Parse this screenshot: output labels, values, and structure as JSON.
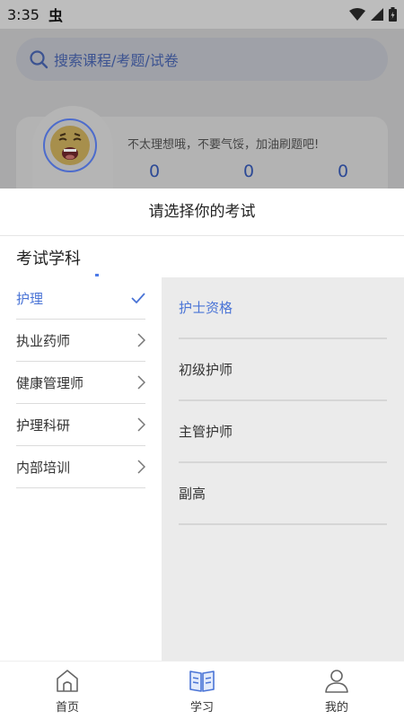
{
  "status_bar": {
    "time": "3:35",
    "app_glyph": "虫"
  },
  "search": {
    "placeholder": "搜索课程/考题/试卷"
  },
  "stats": {
    "motivation": "不太理想哦，不要气馁，加油刷题吧!",
    "values": [
      "0",
      "0",
      "0"
    ]
  },
  "sheet": {
    "title": "请选择你的考试",
    "section_title": "考试学科",
    "categories": [
      {
        "label": "护理",
        "selected": true
      },
      {
        "label": "执业药师",
        "selected": false
      },
      {
        "label": "健康管理师",
        "selected": false
      },
      {
        "label": "护理科研",
        "selected": false
      },
      {
        "label": "内部培训",
        "selected": false
      }
    ],
    "subcategories": [
      {
        "label": "护士资格",
        "selected": true
      },
      {
        "label": "初级护师",
        "selected": false
      },
      {
        "label": "主管护师",
        "selected": false
      },
      {
        "label": "副高",
        "selected": false
      }
    ]
  },
  "bottom_nav": [
    {
      "label": "首页",
      "icon": "home-icon",
      "active": false
    },
    {
      "label": "学习",
      "icon": "book-icon",
      "active": true
    },
    {
      "label": "我的",
      "icon": "user-icon",
      "active": false
    }
  ],
  "colors": {
    "accent": "#4a74d6",
    "dim_overlay": "#a9a9aa",
    "panel": "#ebebeb"
  }
}
